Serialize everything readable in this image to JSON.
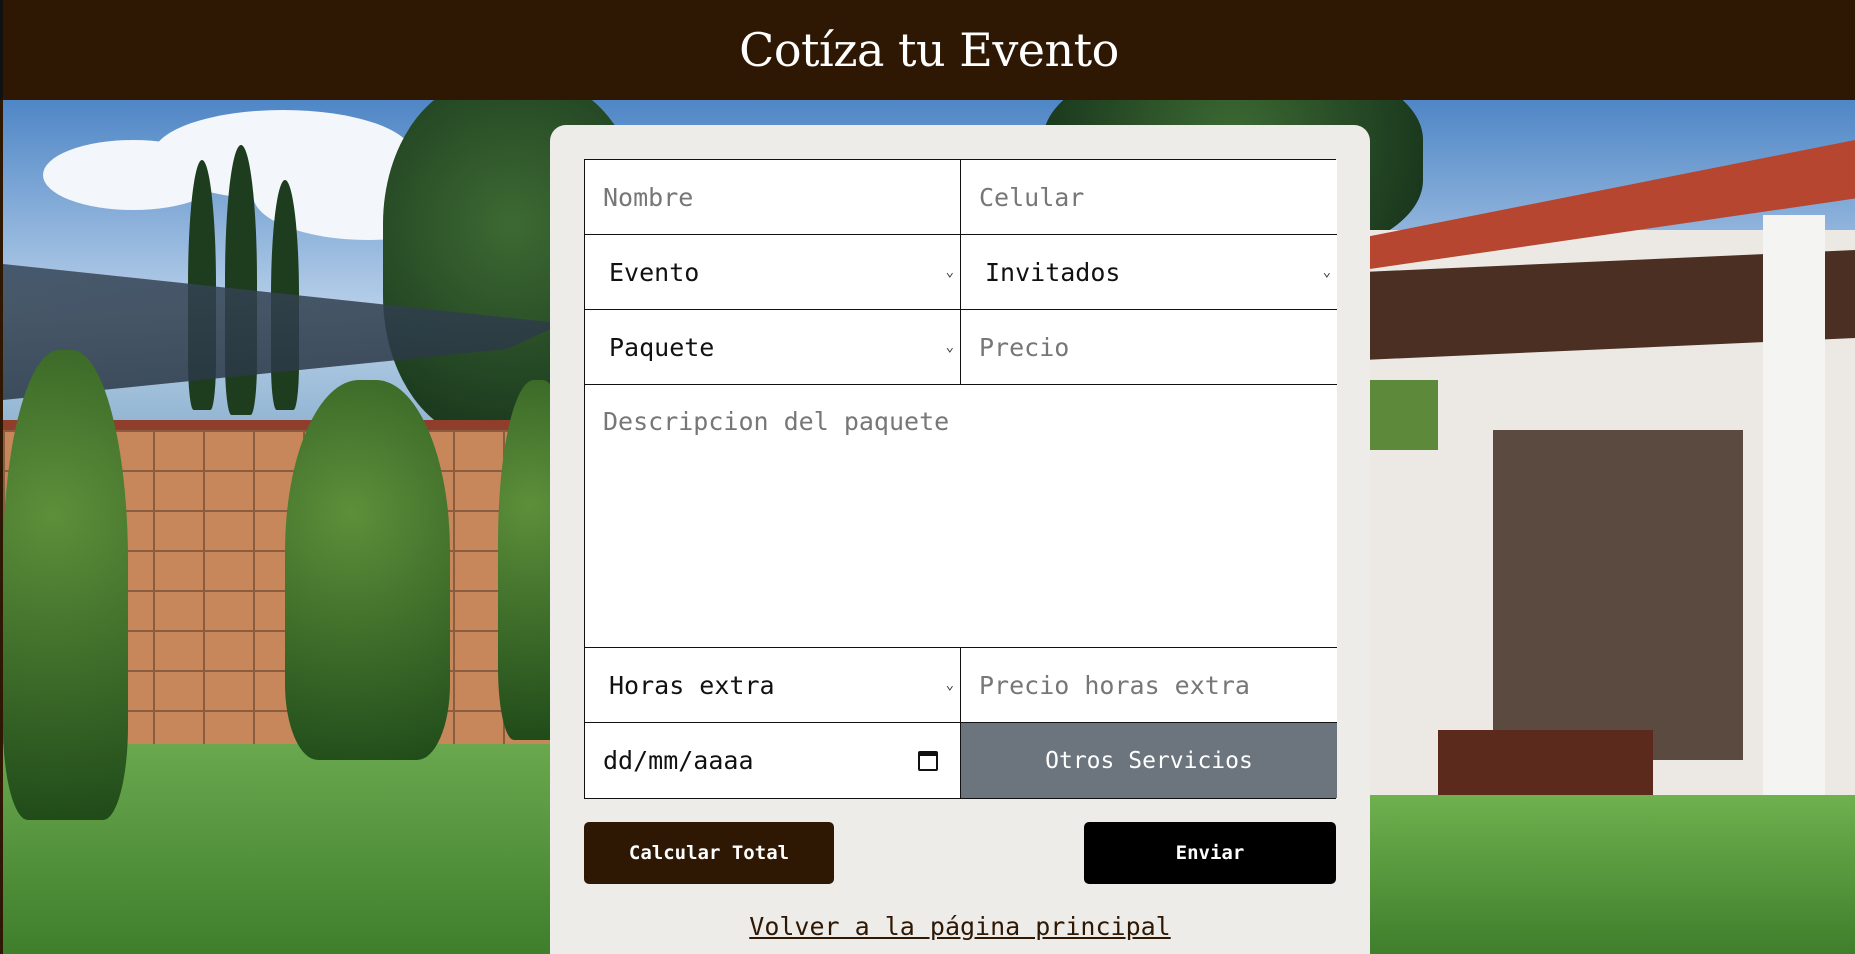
{
  "header": {
    "title": "Cotíza tu Evento"
  },
  "form": {
    "nombre_placeholder": "Nombre",
    "celular_placeholder": "Celular",
    "evento_selected": "Evento",
    "invitados_selected": "Invitados",
    "paquete_selected": "Paquete",
    "precio_placeholder": "Precio",
    "descripcion_placeholder": "Descripcion del paquete",
    "horas_extra_selected": "Horas extra",
    "precio_horas_extra_placeholder": "Precio horas extra",
    "fecha_placeholder": "dd/mm/aaaa",
    "otros_servicios_label": "Otros Servicios"
  },
  "actions": {
    "calcular_label": "Calcular Total",
    "enviar_label": "Enviar",
    "volver_label": "Volver a la página principal"
  },
  "colors": {
    "header_bg": "#2e1803",
    "card_bg": "#eeece9",
    "otros_bg": "#6c757d",
    "send_bg": "#000000"
  }
}
